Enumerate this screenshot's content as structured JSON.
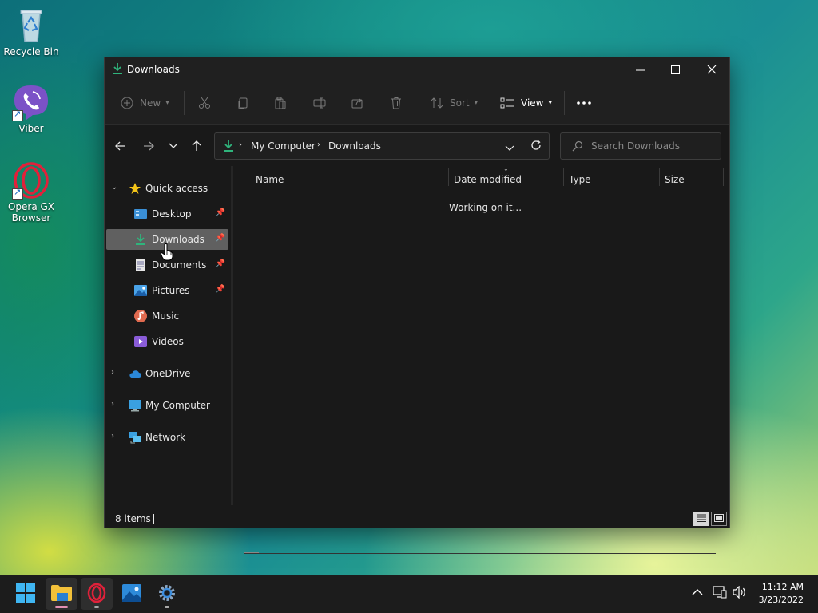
{
  "desktop": {
    "icons": [
      {
        "label": "Recycle Bin"
      },
      {
        "label": "Viber"
      },
      {
        "label": "Opera GX Browser"
      }
    ]
  },
  "window": {
    "title": "Downloads",
    "commands": {
      "new_label": "New",
      "sort_label": "Sort",
      "view_label": "View"
    },
    "address": {
      "segments": [
        "My Computer",
        "Downloads"
      ]
    },
    "search": {
      "placeholder": "Search Downloads"
    },
    "sidebar": {
      "quick_access": "Quick access",
      "items": [
        {
          "label": "Desktop",
          "pinned": true
        },
        {
          "label": "Downloads",
          "pinned": true,
          "selected": true
        },
        {
          "label": "Documents",
          "pinned": true
        },
        {
          "label": "Pictures",
          "pinned": true
        },
        {
          "label": "Music",
          "pinned": false
        },
        {
          "label": "Videos",
          "pinned": false
        }
      ],
      "roots": [
        {
          "label": "OneDrive"
        },
        {
          "label": "My Computer"
        },
        {
          "label": "Network"
        }
      ]
    },
    "columns": {
      "name": "Name",
      "date_modified": "Date modified",
      "type": "Type",
      "size": "Size"
    },
    "loading_text": "Working on it...",
    "status": {
      "item_count": "8 items"
    }
  },
  "taskbar": {
    "clock_time": "11:12 AM",
    "clock_date": "3/23/2022"
  },
  "colors": {
    "accent_green": "#2fb47c",
    "window_bg": "#191919",
    "selected_bg": "#606060",
    "opera_red": "#e0213a"
  }
}
